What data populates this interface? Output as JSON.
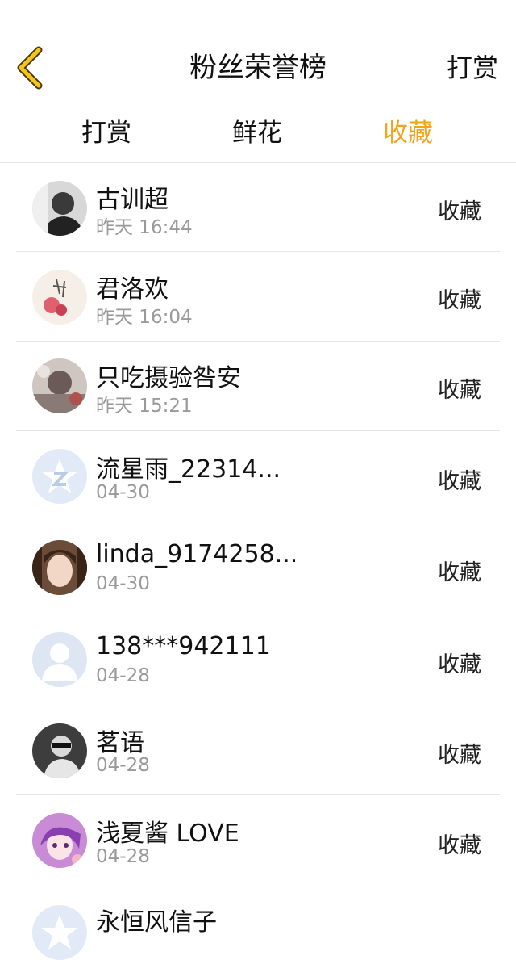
{
  "header": {
    "title": "粉丝荣誉榜",
    "right_action": "打赏",
    "back_icon": "chevron-left-icon"
  },
  "tabs": [
    {
      "label": "打赏",
      "active": false
    },
    {
      "label": "鲜花",
      "active": false
    },
    {
      "label": "收藏",
      "active": true
    }
  ],
  "colors": {
    "accent": "#f2a51b",
    "back_icon": "#f5c518",
    "divider": "#e6e6e6",
    "secondary_text": "#9a9a9a"
  },
  "fans": [
    {
      "name": "古训超",
      "time": "昨天 16:44",
      "action": "收藏"
    },
    {
      "name": "君洛欢",
      "time": "昨天 16:04",
      "action": "收藏"
    },
    {
      "name": "只吃摄验咎安",
      "time": "昨天 15:21",
      "action": "收藏"
    },
    {
      "name": "流星雨_22314...",
      "time": "04-30",
      "action": "收藏"
    },
    {
      "name": "linda_9174258...",
      "time": "04-30",
      "action": "收藏"
    },
    {
      "name": "138***942111",
      "time": "04-28",
      "action": "收藏"
    },
    {
      "name": "茗语",
      "time": "04-28",
      "action": "收藏"
    },
    {
      "name": "浅夏酱 LOVE",
      "time": "04-28",
      "action": "收藏"
    },
    {
      "name": "永恒风信子",
      "time": "",
      "action": ""
    }
  ]
}
